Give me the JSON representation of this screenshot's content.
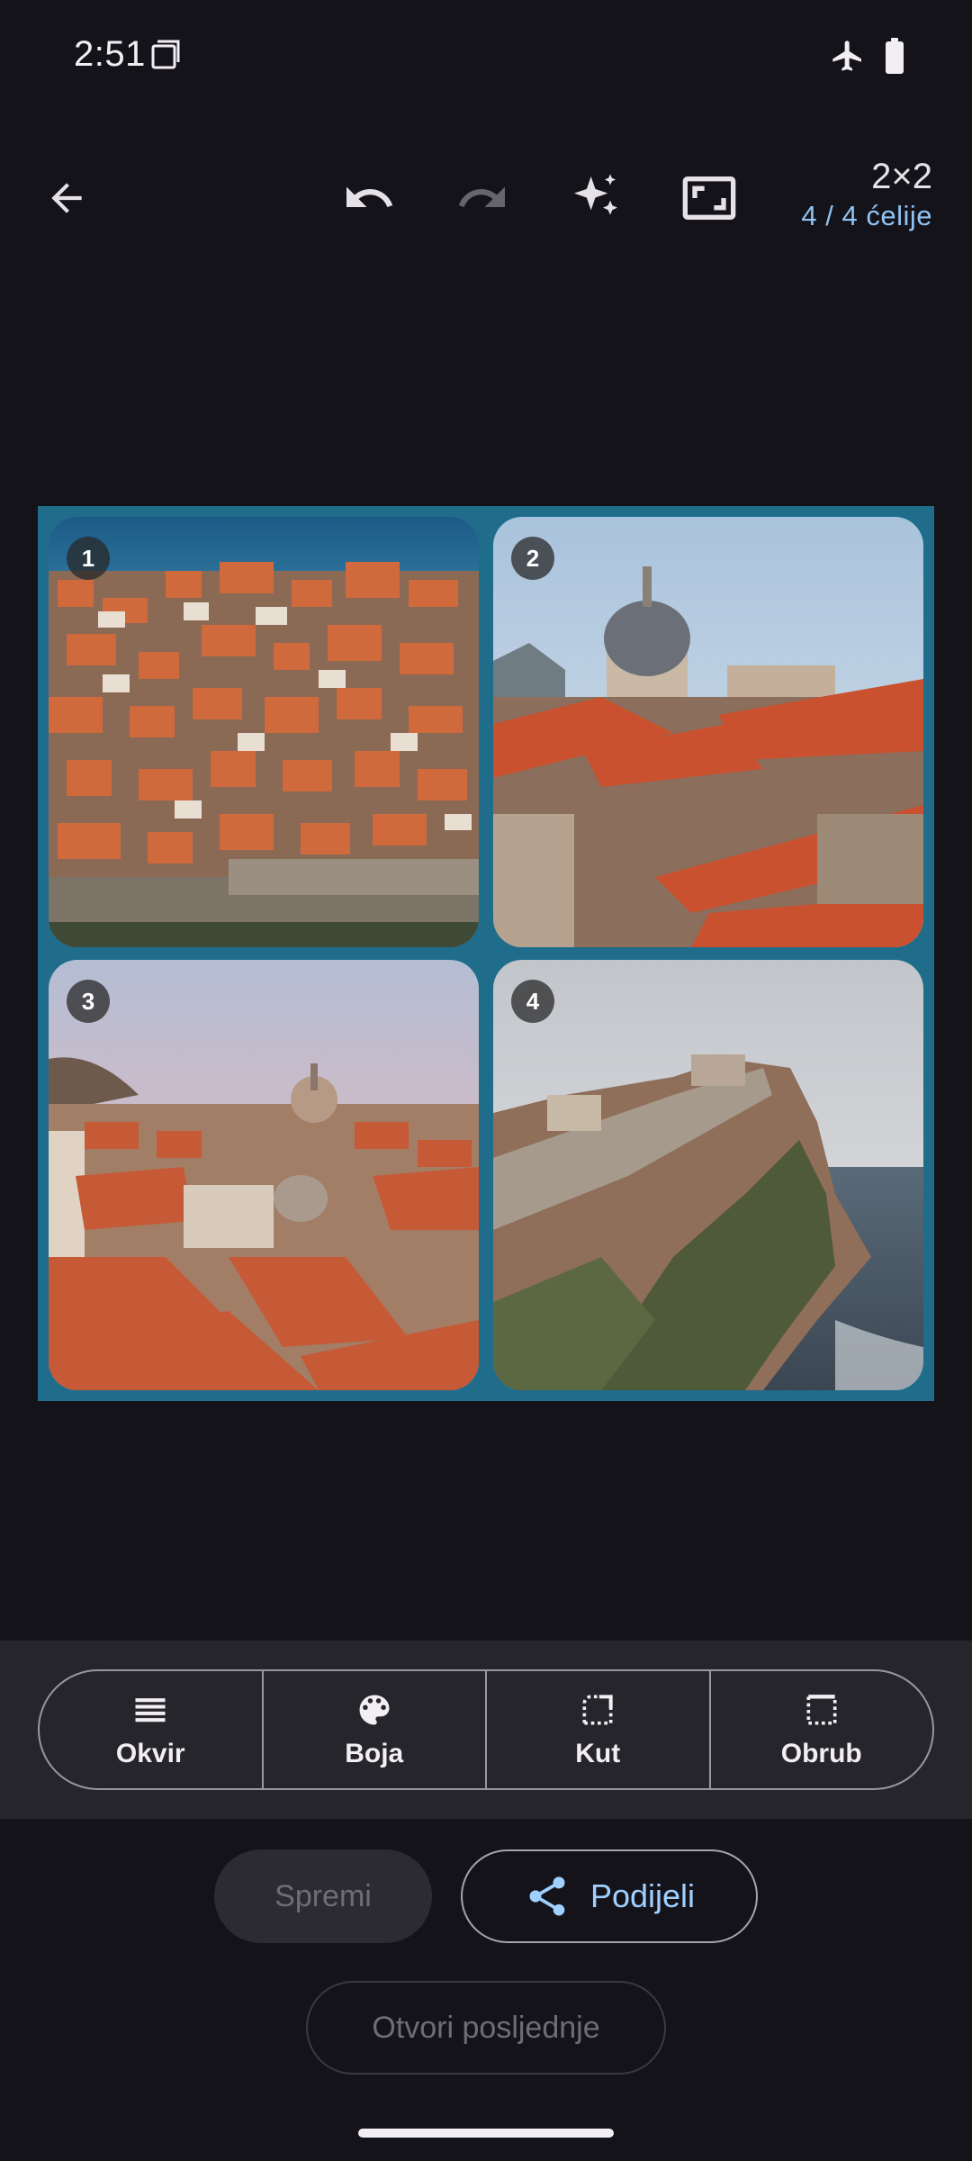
{
  "status_bar": {
    "time": "2:51"
  },
  "toolbar": {
    "grid_size": "2×2",
    "cell_count": "4 / 4 ćelije"
  },
  "collage": {
    "border_color": "#1f6c8b",
    "cells": [
      {
        "number": "1"
      },
      {
        "number": "2"
      },
      {
        "number": "3"
      },
      {
        "number": "4"
      }
    ]
  },
  "tools": [
    {
      "label": "Okvir",
      "icon": "frame-icon"
    },
    {
      "label": "Boja",
      "icon": "palette-icon"
    },
    {
      "label": "Kut",
      "icon": "corner-icon"
    },
    {
      "label": "Obrub",
      "icon": "border-icon"
    }
  ],
  "actions": {
    "save_label": "Spremi",
    "share_label": "Podijeli",
    "open_recent_label": "Otvori posljednje"
  },
  "colors": {
    "accent": "#9fd0ff",
    "background": "#15131a"
  }
}
